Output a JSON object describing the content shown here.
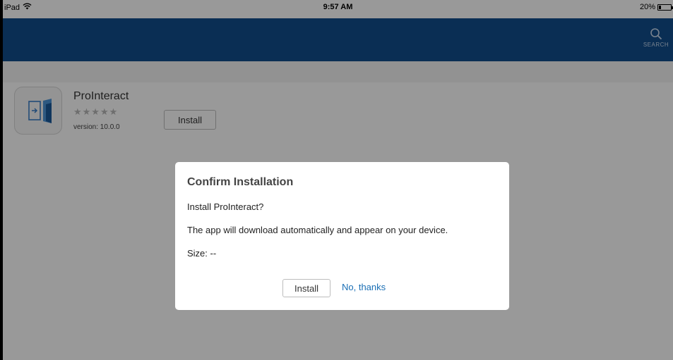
{
  "status_bar": {
    "device": "iPad",
    "time": "9:57 AM",
    "battery_percent_label": "20%",
    "battery_level": 0.2
  },
  "nav_bar": {
    "search_label": "SEARCH",
    "color": "#114e8d"
  },
  "app": {
    "name": "ProInteract",
    "stars": "★★★★★",
    "rating_filled": 0,
    "version": "version: 10.0.0",
    "install_label": "Install"
  },
  "dialog": {
    "title": "Confirm Installation",
    "question": "Install ProInteract?",
    "message": "The app will download automatically and appear on your device.",
    "size": "Size:  --",
    "install_label": "Install",
    "decline_label": "No, thanks",
    "link_color": "#1a6fb5"
  }
}
